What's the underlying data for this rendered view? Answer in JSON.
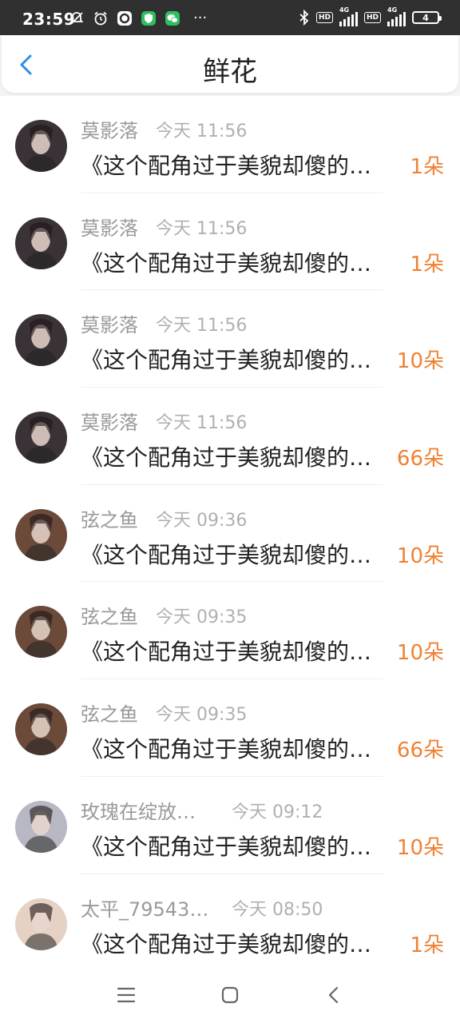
{
  "status_bar": {
    "time": "23:59",
    "network_1": "4G",
    "network_2": "4G",
    "hd_1": "HD",
    "hd_2": "HD",
    "battery": "4",
    "more": "···"
  },
  "header": {
    "title": "鲜花",
    "back_icon": "chevron-left-icon"
  },
  "items": [
    {
      "name": "莫影落",
      "time": "今天 11:56",
      "book": "《这个配角过于美貌却傻的…",
      "flowers": "1朵",
      "avatar_tone": "#3a3236"
    },
    {
      "name": "莫影落",
      "time": "今天 11:56",
      "book": "《这个配角过于美貌却傻的…",
      "flowers": "1朵",
      "avatar_tone": "#3a3236"
    },
    {
      "name": "莫影落",
      "time": "今天 11:56",
      "book": "《这个配角过于美貌却傻的…",
      "flowers": "10朵",
      "avatar_tone": "#3a3236"
    },
    {
      "name": "莫影落",
      "time": "今天 11:56",
      "book": "《这个配角过于美貌却傻的…",
      "flowers": "66朵",
      "avatar_tone": "#3a3236"
    },
    {
      "name": "弦之鱼",
      "time": "今天 09:36",
      "book": "《这个配角过于美貌却傻的…",
      "flowers": "10朵",
      "avatar_tone": "#6b4a3a"
    },
    {
      "name": "弦之鱼",
      "time": "今天 09:35",
      "book": "《这个配角过于美貌却傻的…",
      "flowers": "10朵",
      "avatar_tone": "#6b4a3a"
    },
    {
      "name": "弦之鱼",
      "time": "今天 09:35",
      "book": "《这个配角过于美貌却傻的…",
      "flowers": "66朵",
      "avatar_tone": "#6b4a3a"
    },
    {
      "name": "玫瑰在绽放…",
      "time": "今天 09:12",
      "book": "《这个配角过于美貌却傻的…",
      "flowers": "10朵",
      "avatar_tone": "#b8b8c4"
    },
    {
      "name": "太平_79543…",
      "time": "今天 08:50",
      "book": "《这个配角过于美貌却傻的…",
      "flowers": "1朵",
      "avatar_tone": "#e6d2c4"
    }
  ],
  "nav": {
    "menu_icon": "menu-icon",
    "home_icon": "home-icon",
    "back_icon": "back-icon"
  },
  "colors": {
    "accent": "#2b8ee8",
    "flower_count": "#ef8132"
  }
}
